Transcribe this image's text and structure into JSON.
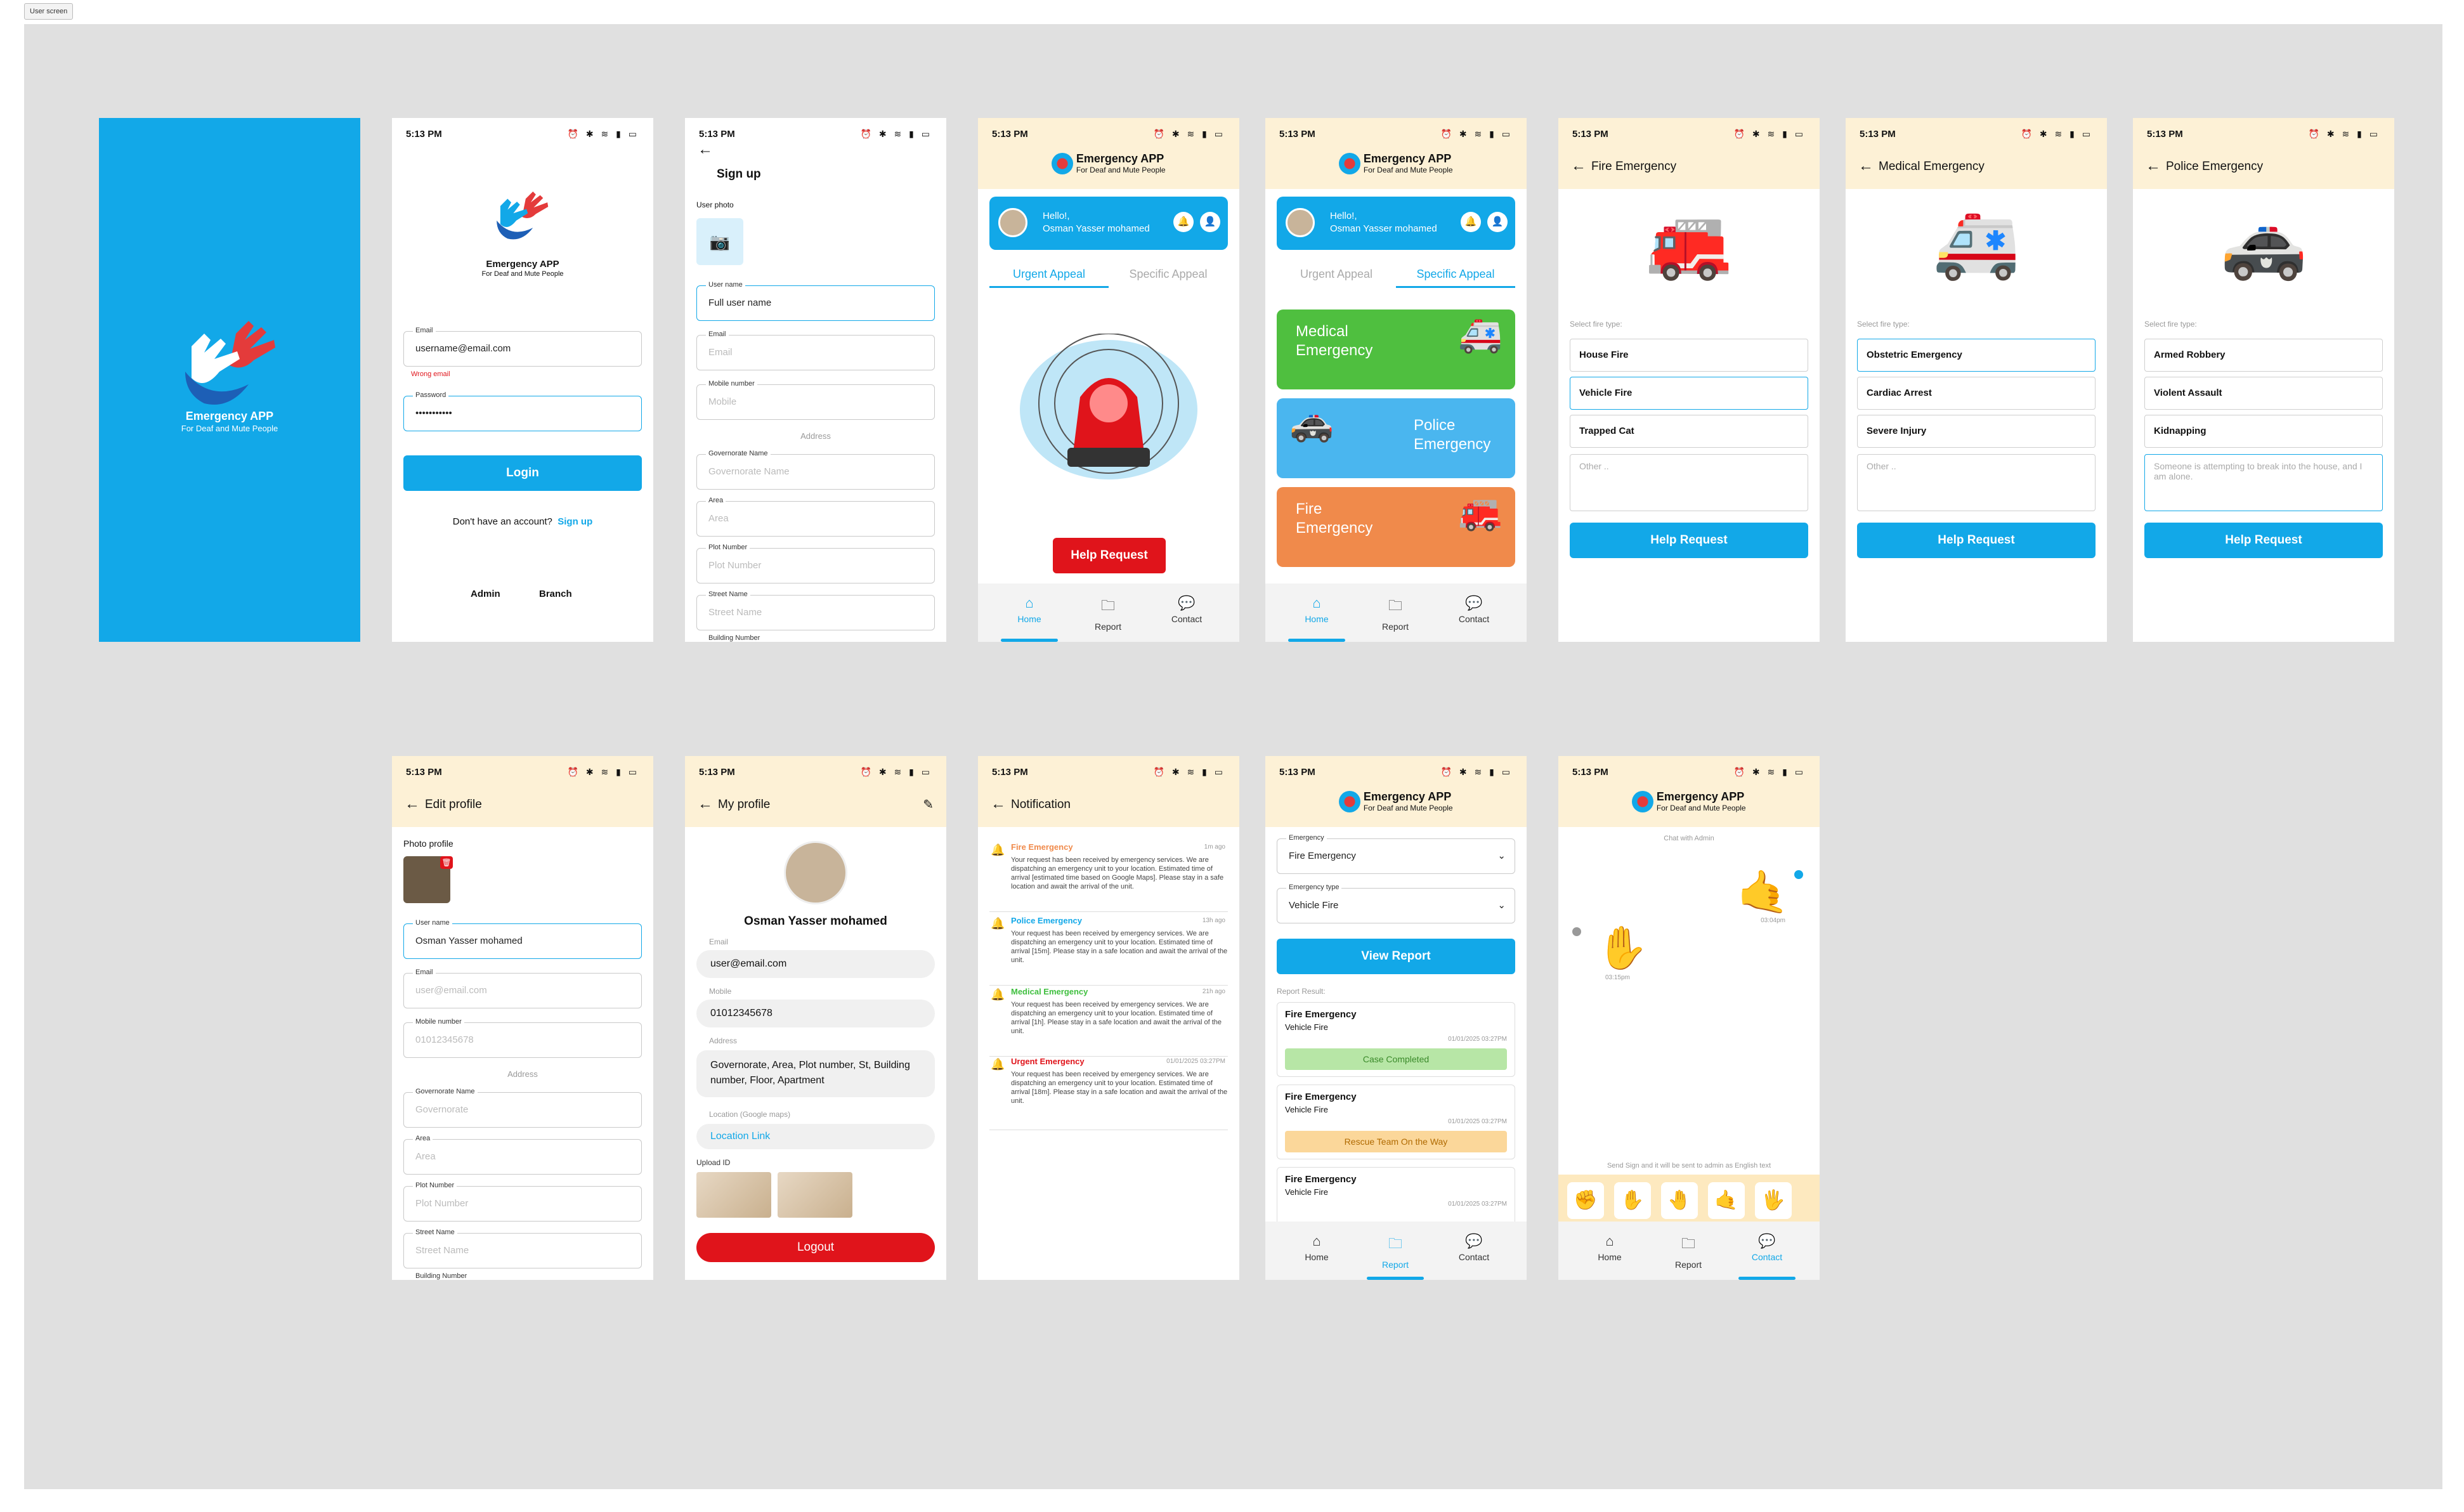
{
  "frame_label": "User screen",
  "status": {
    "time": "5:13 PM",
    "icons": "⏰ ✱ ≋ ▮ ▭"
  },
  "brand": {
    "title": "Emergency APP",
    "subtitle": "For Deaf and Mute People"
  },
  "splash": {
    "title": "Emergency APP",
    "subtitle": "For Deaf and Mute People"
  },
  "login": {
    "email_label": "Email",
    "email_value": "username@email.com",
    "error": "Wrong email",
    "password_label": "Password",
    "password_value": "•••••••••••",
    "login_button": "Login",
    "no_account": "Don't have an account?",
    "signup_link": "Sign up",
    "admin": "Admin",
    "branch": "Branch"
  },
  "signup": {
    "title": "Sign up",
    "photo_label": "User photo",
    "username_label": "User name",
    "username_placeholder": "Full user name",
    "email_label": "Email",
    "email_placeholder": "Email",
    "mobile_label": "Mobile number",
    "mobile_placeholder": "Mobile",
    "address_label": "Address",
    "gov_label": "Governorate Name",
    "gov_placeholder": "Governorate Name",
    "area_label": "Area",
    "area_placeholder": "Area",
    "plot_label": "Plot Number",
    "plot_placeholder": "Plot Number",
    "street_label": "Street Name",
    "street_placeholder": "Street Name",
    "building_label": "Building Number"
  },
  "home": {
    "hello": "Hello!,",
    "user": "Osman Yasser mohamed",
    "tab_urgent": "Urgent Appeal",
    "tab_specific": "Specific Appeal",
    "help_button": "Help Request",
    "cards": {
      "medical": "Medical Emergency",
      "police": "Police Emergency",
      "fire": "Fire Emergency"
    }
  },
  "nav": {
    "home": "Home",
    "report": "Report",
    "contact": "Contact"
  },
  "fire": {
    "title": "Fire Emergency",
    "select_label": "Select fire type:",
    "options": [
      "House Fire",
      "Vehicle Fire",
      "Trapped Cat"
    ],
    "other_placeholder": "Other ..",
    "button": "Help Request"
  },
  "medical": {
    "title": "Medical Emergency",
    "select_label": "Select fire type:",
    "options": [
      "Obstetric Emergency",
      "Cardiac Arrest",
      "Severe Injury"
    ],
    "other_placeholder": "Other ..",
    "button": "Help Request"
  },
  "police": {
    "title": "Police Emergency",
    "select_label": "Select fire type:",
    "options": [
      "Armed Robbery",
      "Violent Assault",
      "Kidnapping"
    ],
    "other_value": "Someone is attempting to break into the house, and I am alone.",
    "button": "Help Request"
  },
  "edit_profile": {
    "title": "Edit profile",
    "photo_label": "Photo profile",
    "username_label": "User name",
    "username_value": "Osman Yasser mohamed",
    "email_label": "Email",
    "email_placeholder": "user@email.com",
    "mobile_label": "Mobile number",
    "mobile_placeholder": "01012345678",
    "address_label": "Address",
    "gov_label": "Governorate Name",
    "gov_placeholder": "Governorate",
    "area_label": "Area",
    "area_placeholder": "Area",
    "plot_label": "Plot Number",
    "plot_placeholder": "Plot Number",
    "street_label": "Street Name",
    "street_placeholder": "Street Name",
    "building_label": "Building Number"
  },
  "my_profile": {
    "title": "My profile",
    "name": "Osman Yasser mohamed",
    "email_label": "Email",
    "email": "user@email.com",
    "mobile_label": "Mobile",
    "mobile": "01012345678",
    "address_label": "Address",
    "address": "Governorate, Area, Plot number, St, Building number, Floor, Apartment",
    "location_label": "Location (Google maps)",
    "location": "Location Link",
    "upload_label": "Upload ID",
    "logout": "Logout"
  },
  "notifications": {
    "title": "Notification",
    "items": [
      {
        "title": "Fire Emergency",
        "time": "1m ago",
        "color": "#f08a4b",
        "body": "Your request has been received by emergency services. We are dispatching an emergency unit to your location. Estimated time of arrival [estimated time based on Google Maps]. Please stay in a safe location and await the arrival of the unit."
      },
      {
        "title": "Police Emergency",
        "time": "13h ago",
        "color": "#12a8e8",
        "body": "Your request has been received by emergency services. We are dispatching an emergency unit to your location. Estimated time of arrival [15m]. Please stay in a safe location and await the arrival of the unit."
      },
      {
        "title": "Medical Emergency",
        "time": "21h ago",
        "color": "#3fbf3f",
        "body": "Your request has been received by emergency services. We are dispatching an emergency unit to your location. Estimated time of arrival [1h]. Please stay in a safe location and await the arrival of the unit."
      },
      {
        "title": "Urgent Emergency",
        "time": "01/01/2025 03:27PM",
        "color": "#e0141b",
        "body": "Your request has been received by emergency services. We are dispatching an emergency unit to your location. Estimated time of arrival [18m]. Please stay in a safe location and await the arrival of the unit."
      }
    ]
  },
  "report": {
    "emergency_label": "Emergency",
    "emergency_value": "Fire Emergency",
    "type_label": "Emergency type",
    "type_value": "Vehicle Fire",
    "view_button": "View Report",
    "result_label": "Report Result:",
    "items": [
      {
        "title": "Fire Emergency",
        "sub": "Vehicle Fire",
        "date": "01/01/2025 03:27PM",
        "status": "Case Completed",
        "status_color": "#b7e6a6",
        "status_text": "#3a8a2a"
      },
      {
        "title": "Fire Emergency",
        "sub": "Vehicle Fire",
        "date": "01/01/2025 03:27PM",
        "status": "Rescue Team On the Way",
        "status_color": "#fbd79a",
        "status_text": "#b06a00"
      },
      {
        "title": "Fire Emergency",
        "sub": "Vehicle Fire",
        "date": "01/01/2025 03:27PM",
        "status": "",
        "status_color": "#dddddd",
        "status_text": "#333"
      }
    ]
  },
  "chat": {
    "header": "Chat with Admin",
    "time1": "03:04pm",
    "time2": "03:15pm",
    "hint": "Send Sign and it will be sent to admin as English text",
    "signs": [
      "✊",
      "✋",
      "🤚",
      "🤙",
      "🖐"
    ]
  },
  "colors": {
    "primary": "#12a8e8",
    "danger": "#e0141b",
    "cream": "#fdf1d6",
    "medical": "#4fbf3f",
    "police": "#4ab6ef",
    "fire": "#f08a4b"
  }
}
